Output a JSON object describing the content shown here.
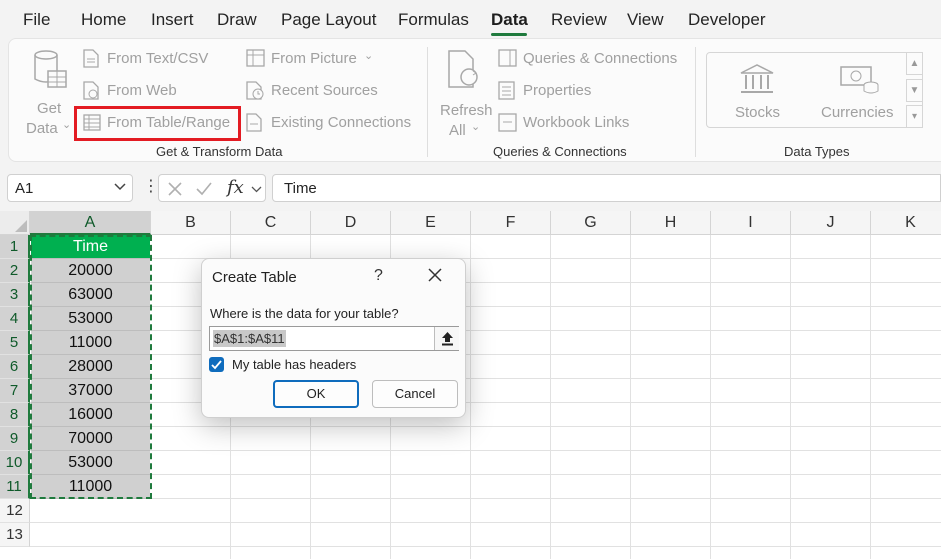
{
  "menu": {
    "tabs": [
      "File",
      "Home",
      "Insert",
      "Draw",
      "Page Layout",
      "Formulas",
      "Data",
      "Review",
      "View",
      "Developer"
    ],
    "active_tab": "Data"
  },
  "ribbon": {
    "get_data": {
      "line1": "Get",
      "line2": "Data"
    },
    "from_text_csv": "From Text/CSV",
    "from_web": "From Web",
    "from_table_range": "From Table/Range",
    "from_picture": "From Picture",
    "recent_sources": "Recent Sources",
    "existing_connections": "Existing Connections",
    "refresh": {
      "line1": "Refresh",
      "line2": "All"
    },
    "queries_connections": "Queries & Connections",
    "properties": "Properties",
    "workbook_links": "Workbook Links",
    "stocks": "Stocks",
    "currencies": "Currencies",
    "groups": {
      "get_transform": "Get & Transform Data",
      "queries": "Queries & Connections",
      "data_types": "Data Types"
    }
  },
  "formula_bar": {
    "name_box": "A1",
    "fx_label": "fx",
    "formula": "Time"
  },
  "grid": {
    "columns": [
      "A",
      "B",
      "C",
      "D",
      "E",
      "F",
      "G",
      "H",
      "I",
      "J",
      "K"
    ],
    "rows": [
      "1",
      "2",
      "3",
      "4",
      "5",
      "6",
      "7",
      "8",
      "9",
      "10",
      "11",
      "12",
      "13"
    ],
    "column_a": [
      "Time",
      "20000",
      "63000",
      "53000",
      "11000",
      "28000",
      "37000",
      "16000",
      "70000",
      "53000",
      "11000"
    ]
  },
  "dialog": {
    "title": "Create Table",
    "help": "?",
    "prompt": "Where is the data for your table?",
    "range": "$A$1:$A$11",
    "checkbox_label": "My table has headers",
    "checkbox_checked": true,
    "ok_label": "OK",
    "cancel_label": "Cancel"
  },
  "colors": {
    "accent_green": "#1f7a3d",
    "header_fill": "#00b050",
    "highlight_red": "#e31b23",
    "checkbox_blue": "#0f6cbd"
  }
}
